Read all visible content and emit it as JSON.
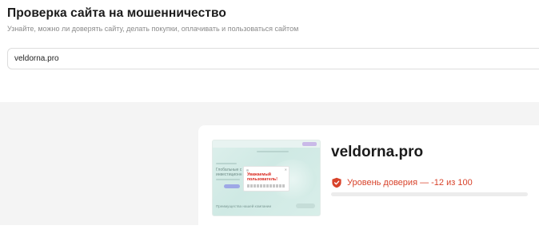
{
  "header": {
    "title": "Проверка сайта на мошенничество",
    "subtitle": "Узнайте, можно ли доверять сайту, делать покупки, оплачивать и пользоваться сайтом"
  },
  "search": {
    "value": "veldorna.pro"
  },
  "result": {
    "domain": "veldorna.pro",
    "trust_label": "Уровень доверия — -12 из 100",
    "trust_score": -12,
    "trust_max": 100,
    "status_color": "#d8432b",
    "icon": "shield-icon",
    "preview": {
      "headline": "Глобальные с инвестиционн",
      "modal_warning": "Уважаемый пользователь!",
      "footer_text": "Преимущества нашей компании"
    }
  }
}
